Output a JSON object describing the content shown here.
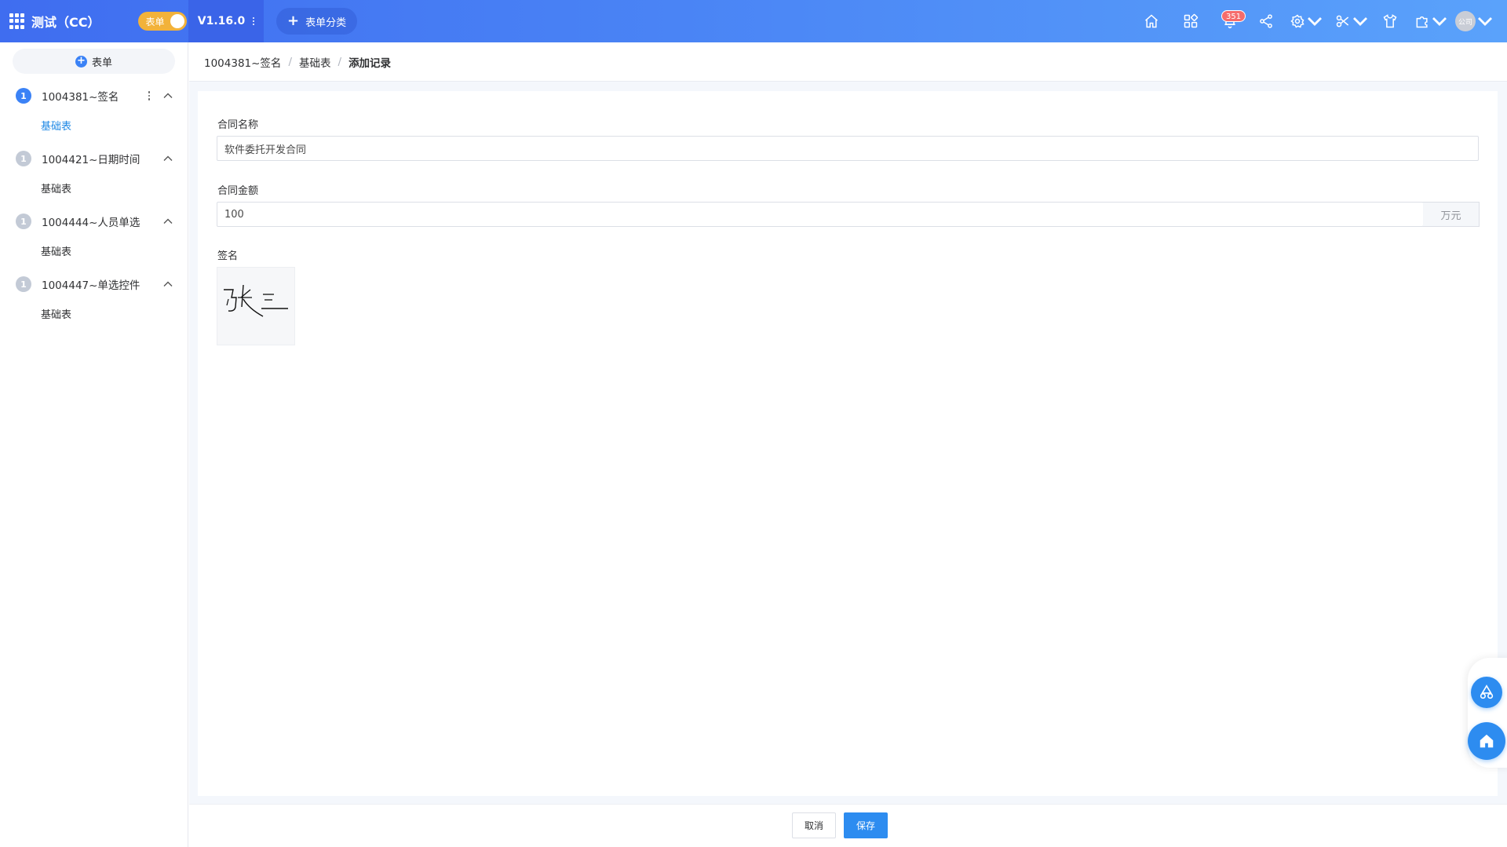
{
  "header": {
    "app_title": "测试（CC）",
    "mode_toggle_label": "表单",
    "version": "V1.16.0",
    "add_category_label": "表单分类",
    "notification_count": "351",
    "avatar_text": "公司"
  },
  "sidebar": {
    "add_form_label": "表单",
    "groups": [
      {
        "num": "1",
        "title": "1004381~签名",
        "active": true,
        "items": [
          {
            "label": "基础表",
            "active": true
          }
        ]
      },
      {
        "num": "1",
        "title": "1004421~日期时间",
        "active": false,
        "items": [
          {
            "label": "基础表",
            "active": false
          }
        ]
      },
      {
        "num": "1",
        "title": "1004444~人员单选",
        "active": false,
        "items": [
          {
            "label": "基础表",
            "active": false
          }
        ]
      },
      {
        "num": "1",
        "title": "1004447~单选控件",
        "active": false,
        "items": [
          {
            "label": "基础表",
            "active": false
          }
        ]
      }
    ]
  },
  "breadcrumb": {
    "items": [
      "1004381~签名",
      "基础表",
      "添加记录"
    ],
    "separator": "/"
  },
  "form": {
    "contract_name_label": "合同名称",
    "contract_name_value": "软件委托开发合同",
    "contract_amount_label": "合同金额",
    "contract_amount_value": "100",
    "contract_amount_unit": "万元",
    "signature_label": "签名",
    "signature_text": "张三"
  },
  "footer": {
    "cancel_label": "取消",
    "save_label": "保存"
  },
  "colors": {
    "primary": "#2d8cf0",
    "header_gradient_start": "#3f6df0",
    "header_gradient_end": "#5aa2fb",
    "toggle": "#f2b23a",
    "badge": "#f56c6c"
  }
}
